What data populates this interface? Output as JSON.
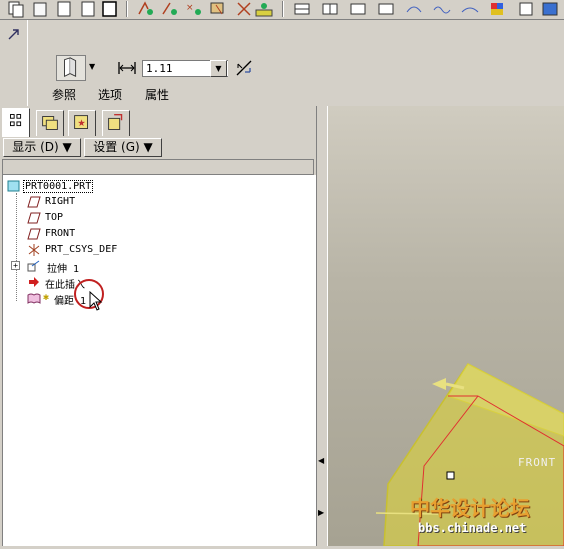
{
  "dashboard": {
    "depth_value": "1.11",
    "tabs": [
      "参照",
      "选项",
      "属性"
    ]
  },
  "panel": {
    "menu_show": "显示 (D) ▼",
    "menu_settings": "设置 (G) ▼"
  },
  "tree": {
    "root": "PRT0001.PRT",
    "items": [
      "RIGHT",
      "TOP",
      "FRONT",
      "PRT_CSYS_DEF",
      "拉伸 1",
      "在此插入",
      "偏距 1"
    ]
  },
  "viewport": {
    "datum_label": "FRONT"
  },
  "watermark": {
    "title": "中华设计论坛",
    "url": "bbs.chinade.net"
  },
  "colors": {
    "accent_yellow": "#d8d040",
    "edge_red": "#e03030",
    "viewport_bg": "#b8b4a6"
  }
}
